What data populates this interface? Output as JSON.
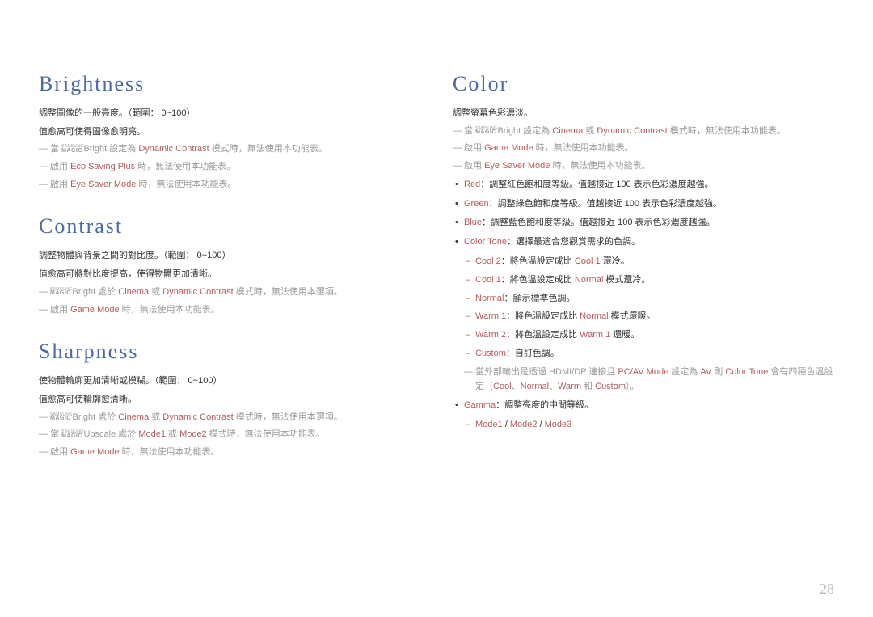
{
  "pageNumber": "28",
  "magic": {
    "top": "SAMSUNG",
    "bottom": "MAGIC"
  },
  "left": {
    "brightness": {
      "title": "Brightness",
      "p1": "調整圖像的一般亮度。（範圍： 0~100）",
      "p2": "值愈高可使得圖像愈明亮。",
      "n1a": "當 ",
      "n1b": "Bright 設定為 ",
      "n1c": "Dynamic Contrast",
      "n1d": " 模式時，無法使用本功能表。",
      "n2a": "啟用 ",
      "n2b": "Eco Saving Plus",
      "n2c": " 時，無法使用本功能表。",
      "n3a": "啟用 ",
      "n3b": "Eye Saver Mode",
      "n3c": " 時，無法使用本功能表。"
    },
    "contrast": {
      "title": "Contrast",
      "p1": "調整物體與背景之間的對比度。（範圍： 0~100）",
      "p2": "值愈高可將對比度提高，使得物體更加清晰。",
      "n1b": "Bright 處於 ",
      "n1c": "Cinema",
      "n1d": " 或 ",
      "n1e": "Dynamic Contrast",
      "n1f": " 模式時，無法使用本選項。",
      "n2a": "啟用 ",
      "n2b": "Game Mode",
      "n2c": " 時，無法使用本功能表。"
    },
    "sharpness": {
      "title": "Sharpness",
      "p1": "使物體輪廓更加清晰或模糊。（範圍： 0~100）",
      "p2": "值愈高可使輪廓愈清晰。",
      "n1b": "Bright 處於 ",
      "n1c": "Cinema",
      "n1d": " 或 ",
      "n1e": "Dynamic Contrast",
      "n1f": " 模式時，無法使用本選項。",
      "n2a": "當 ",
      "n2b": "Upscale 處於 ",
      "n2c": "Mode1",
      "n2d": " 或 ",
      "n2e": "Mode2",
      "n2f": " 模式時，無法使用本功能表。",
      "n3a": "啟用 ",
      "n3b": "Game Mode",
      "n3c": " 時，無法使用本功能表。"
    }
  },
  "right": {
    "color": {
      "title": "Color",
      "p1": "調整螢幕色彩濃淡。",
      "n1a": "當 ",
      "n1b": "Bright 設定為 ",
      "n1c": "Cinema",
      "n1d": " 或 ",
      "n1e": "Dynamic Contrast",
      "n1f": " 模式時，無法使用本功能表。",
      "n2a": "啟用 ",
      "n2b": "Game Mode",
      "n2c": " 時，無法使用本功能表。",
      "n3a": "啟用 ",
      "n3b": "Eye Saver Mode",
      "n3c": " 時，無法使用本功能表。",
      "b_red_k": "Red",
      "b_red_v": "：調整紅色飽和度等級。值越接近 100 表示色彩濃度越強。",
      "b_green_k": "Green",
      "b_green_v": "：調整綠色飽和度等級。值越接近 100 表示色彩濃度越強。",
      "b_blue_k": "Blue",
      "b_blue_v": "：調整藍色飽和度等級。值越接近 100 表示色彩濃度越強。",
      "b_ct_k": "Color Tone",
      "b_ct_v": "：選擇最適合您觀賞需求的色調。",
      "s_cool2_k": "Cool 2",
      "s_cool2_v1": "：將色溫設定成比 ",
      "s_cool2_v2": "Cool 1",
      "s_cool2_v3": " 還冷。",
      "s_cool1_k": "Cool 1",
      "s_cool1_v1": "：將色溫設定成比 ",
      "s_cool1_v2": "Normal",
      "s_cool1_v3": " 模式還冷。",
      "s_normal_k": "Normal",
      "s_normal_v": "：顯示標準色調。",
      "s_warm1_k": "Warm 1",
      "s_warm1_v1": "：將色溫設定成比 ",
      "s_warm1_v2": "Normal",
      "s_warm1_v3": " 模式還暖。",
      "s_warm2_k": "Warm 2",
      "s_warm2_v1": "：將色溫設定成比 ",
      "s_warm2_v2": "Warm 1",
      "s_warm2_v3": " 還暖。",
      "s_custom_k": "Custom",
      "s_custom_v": "：自訂色調。",
      "nn1": "當外部輸出是透過 HDMI/DP 連接且 ",
      "nn2": "PC/AV Mode",
      "nn3": " 設定為 ",
      "nn4": "AV",
      "nn5": " 則 ",
      "nn6": "Color Tone",
      "nn7": " 會有四種色溫設定（",
      "nn8": "Cool",
      "nn9": "、",
      "nn10": "Normal",
      "nn11": "、",
      "nn12": "Warm",
      "nn13": " 和 ",
      "nn14": "Custom",
      "nn15": "）。",
      "b_gamma_k": "Gamma",
      "b_gamma_v": "：調整亮度的中間等級。",
      "s_modes_1": "Mode1",
      "s_modes_2": " / ",
      "s_modes_3": "Mode2",
      "s_modes_4": " / ",
      "s_modes_5": "Mode3"
    }
  }
}
